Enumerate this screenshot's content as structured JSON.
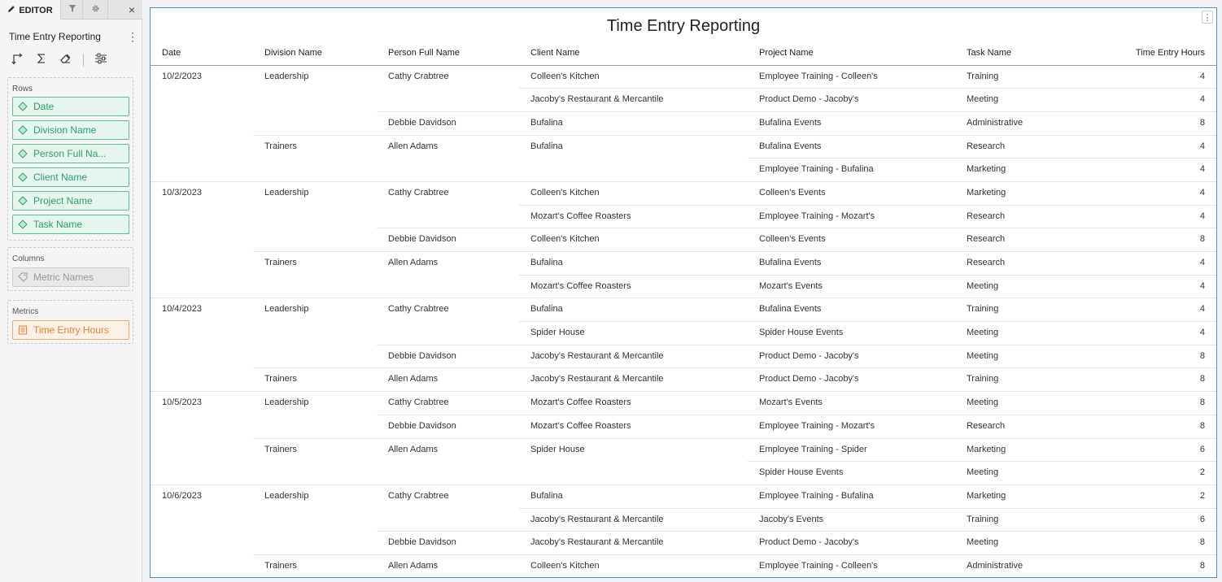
{
  "editor": {
    "tabs": {
      "editor": "EDITOR",
      "close": "×"
    },
    "title": "Time Entry Reporting",
    "rows_label": "Rows",
    "rows": [
      "Date",
      "Division Name",
      "Person Full Na...",
      "Client Name",
      "Project Name",
      "Task Name"
    ],
    "columns_label": "Columns",
    "columns": [
      "Metric Names"
    ],
    "metrics_label": "Metrics",
    "metrics": [
      "Time Entry Hours"
    ],
    "colors": {
      "dimension": "#2aa271",
      "metric": "#e8832e",
      "accent": "#4a90d9"
    }
  },
  "report": {
    "title": "Time Entry Reporting",
    "headers": [
      "Date",
      "Division Name",
      "Person Full Name",
      "Client Name",
      "Project Name",
      "Task Name",
      "Time Entry Hours"
    ],
    "rows": [
      [
        "10/2/2023",
        "Leadership",
        "Cathy Crabtree",
        "Colleen's Kitchen",
        "Employee Training - Colleen's",
        "Training",
        "4"
      ],
      [
        "",
        "",
        "",
        "Jacoby's Restaurant & Mercantile",
        "Product Demo - Jacoby's",
        "Meeting",
        "4"
      ],
      [
        "",
        "",
        "Debbie Davidson",
        "Bufalina",
        "Bufalina Events",
        "Administrative",
        "8"
      ],
      [
        "",
        "Trainers",
        "Allen Adams",
        "Bufalina",
        "Bufalina Events",
        "Research",
        "4"
      ],
      [
        "",
        "",
        "",
        "",
        "Employee Training - Bufalina",
        "Marketing",
        "4"
      ],
      [
        "10/3/2023",
        "Leadership",
        "Cathy Crabtree",
        "Colleen's Kitchen",
        "Colleen's Events",
        "Marketing",
        "4"
      ],
      [
        "",
        "",
        "",
        "Mozart's Coffee Roasters",
        "Employee Training - Mozart's",
        "Research",
        "4"
      ],
      [
        "",
        "",
        "Debbie Davidson",
        "Colleen's Kitchen",
        "Colleen's Events",
        "Research",
        "8"
      ],
      [
        "",
        "Trainers",
        "Allen Adams",
        "Bufalina",
        "Bufalina Events",
        "Research",
        "4"
      ],
      [
        "",
        "",
        "",
        "Mozart's Coffee Roasters",
        "Mozart's Events",
        "Meeting",
        "4"
      ],
      [
        "10/4/2023",
        "Leadership",
        "Cathy Crabtree",
        "Bufalina",
        "Bufalina Events",
        "Training",
        "4"
      ],
      [
        "",
        "",
        "",
        "Spider House",
        "Spider House Events",
        "Meeting",
        "4"
      ],
      [
        "",
        "",
        "Debbie Davidson",
        "Jacoby's Restaurant & Mercantile",
        "Product Demo - Jacoby's",
        "Meeting",
        "8"
      ],
      [
        "",
        "Trainers",
        "Allen Adams",
        "Jacoby's Restaurant & Mercantile",
        "Product Demo - Jacoby's",
        "Training",
        "8"
      ],
      [
        "10/5/2023",
        "Leadership",
        "Cathy Crabtree",
        "Mozart's Coffee Roasters",
        "Mozart's Events",
        "Meeting",
        "8"
      ],
      [
        "",
        "",
        "Debbie Davidson",
        "Mozart's Coffee Roasters",
        "Employee Training - Mozart's",
        "Research",
        "8"
      ],
      [
        "",
        "Trainers",
        "Allen Adams",
        "Spider House",
        "Employee Training - Spider",
        "Marketing",
        "6"
      ],
      [
        "",
        "",
        "",
        "",
        "Spider House Events",
        "Meeting",
        "2"
      ],
      [
        "10/6/2023",
        "Leadership",
        "Cathy Crabtree",
        "Bufalina",
        "Employee Training - Bufalina",
        "Marketing",
        "2"
      ],
      [
        "",
        "",
        "",
        "Jacoby's Restaurant & Mercantile",
        "Jacoby's Events",
        "Training",
        "6"
      ],
      [
        "",
        "",
        "Debbie Davidson",
        "Jacoby's Restaurant & Mercantile",
        "Product Demo - Jacoby's",
        "Meeting",
        "8"
      ],
      [
        "",
        "Trainers",
        "Allen Adams",
        "Colleen's Kitchen",
        "Employee Training - Colleen's",
        "Administrative",
        "8"
      ]
    ]
  }
}
